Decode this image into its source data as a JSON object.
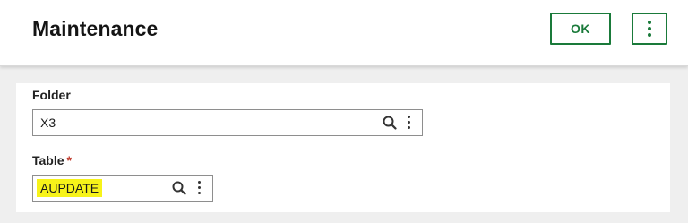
{
  "header": {
    "title": "Maintenance",
    "ok_label": "OK"
  },
  "fields": {
    "folder": {
      "label": "Folder",
      "value": "X3"
    },
    "table": {
      "label": "Table",
      "required_mark": "*",
      "value": "AUPDATE"
    }
  },
  "icons": {
    "search": "search-icon",
    "more": "more-vertical-icon"
  },
  "colors": {
    "accent": "#1a7a3a",
    "required": "#c0392b",
    "highlight": "#f7f319"
  }
}
